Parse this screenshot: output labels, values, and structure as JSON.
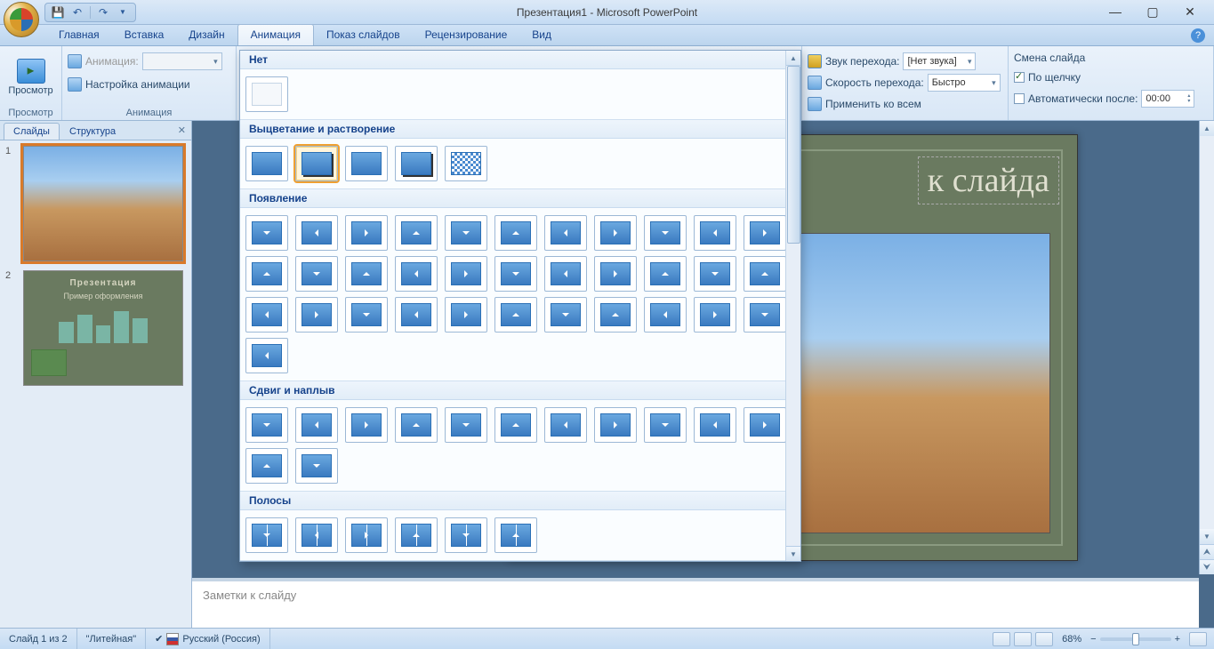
{
  "titlebar": {
    "title": "Презентация1 - Microsoft PowerPoint"
  },
  "tabs": [
    "Главная",
    "Вставка",
    "Дизайн",
    "Анимация",
    "Показ слайдов",
    "Рецензирование",
    "Вид"
  ],
  "active_tab_index": 3,
  "ribbon": {
    "preview": {
      "button": "Просмотр",
      "group": "Просмотр"
    },
    "animation": {
      "anim_label": "Анимация:",
      "anim_value": "",
      "custom": "Настройка анимации",
      "group": "Анимация"
    },
    "transition_sound": {
      "label": "Звук перехода:",
      "value": "[Нет звука]"
    },
    "transition_speed": {
      "label": "Скорость перехода:",
      "value": "Быстро"
    },
    "apply_all": "Применить ко всем",
    "advance": {
      "group": "Смена слайда",
      "on_click": "По щелчку",
      "auto_after": "Автоматически после:",
      "time": "00:00"
    }
  },
  "gallery": {
    "cat_none": "Нет",
    "cat_fade": "Выцветание и растворение",
    "cat_appear": "Появление",
    "cat_push": "Сдвиг и наплыв",
    "cat_stripes": "Полосы"
  },
  "leftpanel": {
    "tab_slides": "Слайды",
    "tab_outline": "Структура",
    "slides": [
      {
        "num": "1"
      },
      {
        "num": "2",
        "title": "Презентация",
        "subtitle": "Пример оформления"
      }
    ]
  },
  "slide": {
    "title_placeholder": "к слайда"
  },
  "notes": {
    "placeholder": "Заметки к слайду"
  },
  "statusbar": {
    "slide_pos": "Слайд 1 из 2",
    "theme": "\"Литейная\"",
    "lang": "Русский (Россия)",
    "zoom": "68%"
  }
}
